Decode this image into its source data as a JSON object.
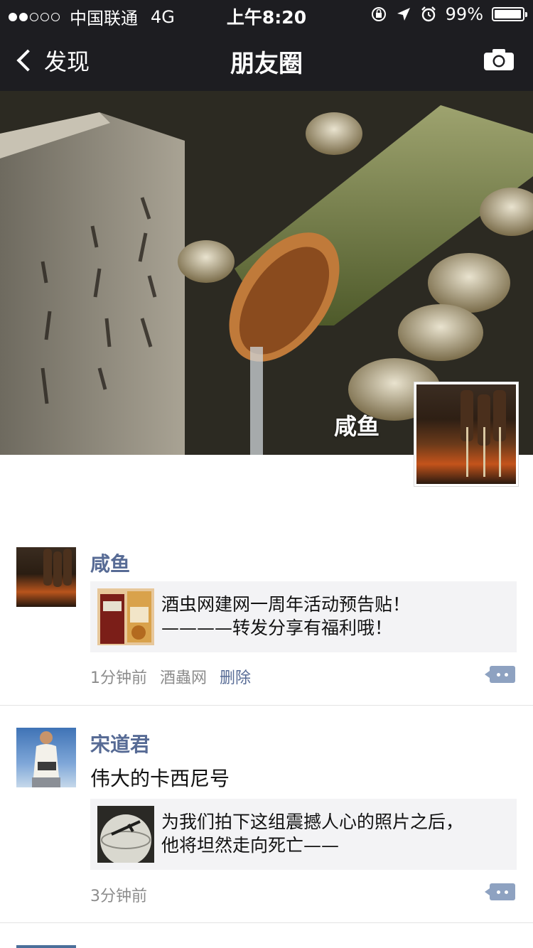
{
  "status_bar": {
    "carrier": "中国联通",
    "network": "4G",
    "time": "上午8:20",
    "battery": "99%",
    "signal_bars_filled": 2,
    "signal_bars_total": 5
  },
  "nav": {
    "back_label": "发现",
    "title": "朋友圈",
    "camera_icon": "camera-icon"
  },
  "cover": {
    "user_name": "咸鱼"
  },
  "posts": [
    {
      "author": "咸鱼",
      "text": "",
      "link": "酒虫网建网一周年活动预告贴！\n————转发分享有福利哦！",
      "time": "1分钟前",
      "source": "酒蟲网",
      "delete_label": "删除"
    },
    {
      "author": "宋道君",
      "text": "伟大的卡西尼号",
      "link": "为我们拍下这组震撼人心的照片之后，\n他将坦然走向死亡——",
      "time": "3分钟前"
    }
  ],
  "colors": {
    "nav_bg": "#1d1d21",
    "name_link": "#576b95",
    "card_bg": "#f3f3f5"
  }
}
